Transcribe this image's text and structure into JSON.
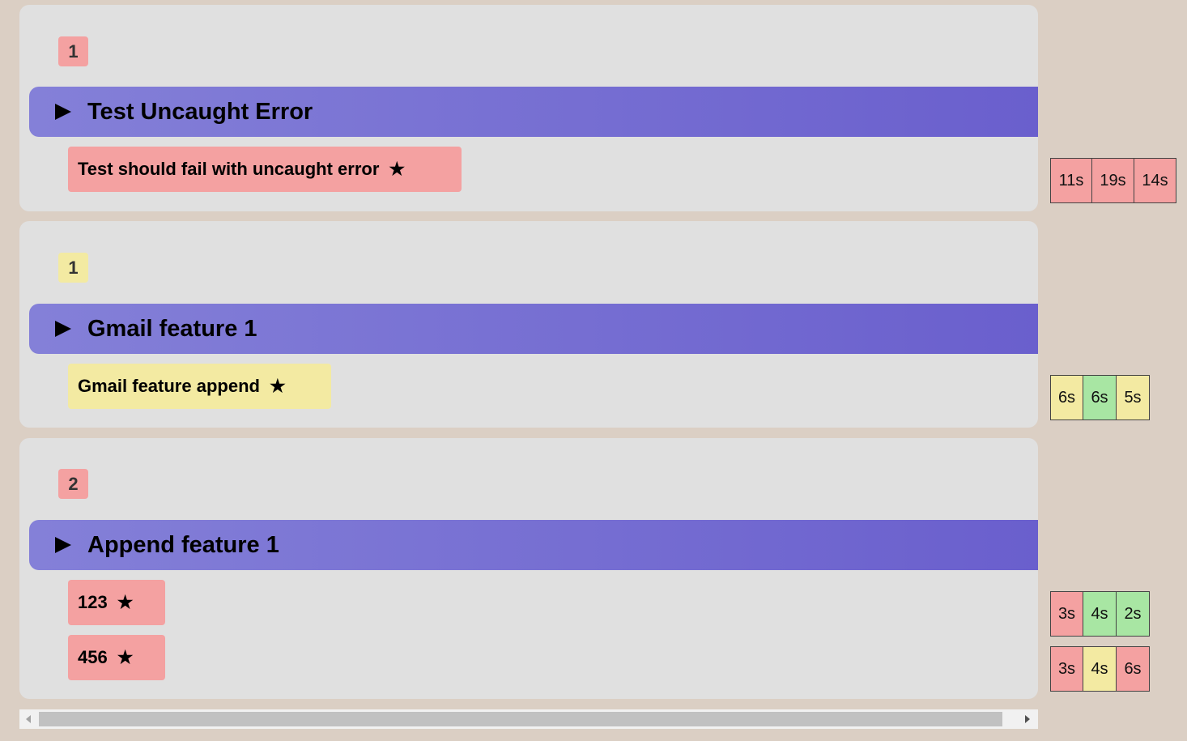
{
  "suites": [
    {
      "count": "1",
      "feature": "Test Uncaught Error",
      "scenarios": [
        {
          "label": "Test should fail with uncaught error",
          "star": "★",
          "runs": [
            "11s",
            "19s",
            "14s"
          ]
        }
      ]
    },
    {
      "count": "1",
      "feature": "Gmail feature 1",
      "scenarios": [
        {
          "label": "Gmail feature append",
          "star": "★",
          "runs": [
            "6s",
            "6s",
            "5s"
          ]
        }
      ]
    },
    {
      "count": "2",
      "feature": "Append feature 1",
      "scenarios": [
        {
          "label": "123",
          "star": "★",
          "runs": [
            "3s",
            "4s",
            "2s"
          ]
        },
        {
          "label": "456",
          "star": "★",
          "runs": [
            "3s",
            "4s",
            "6s"
          ]
        }
      ]
    }
  ],
  "colors": {
    "fail": "#f4a1a1",
    "warn": "#f3eaa2",
    "pass": "#a8e6a3",
    "header_start": "#8480d8",
    "header_end": "#6a5fcd"
  },
  "run_status": [
    [
      [
        "fail",
        "fail",
        "fail"
      ]
    ],
    [
      [
        "warn",
        "pass",
        "warn"
      ]
    ],
    [
      [
        "fail",
        "pass",
        "pass"
      ],
      [
        "fail",
        "warn",
        "fail"
      ]
    ]
  ]
}
